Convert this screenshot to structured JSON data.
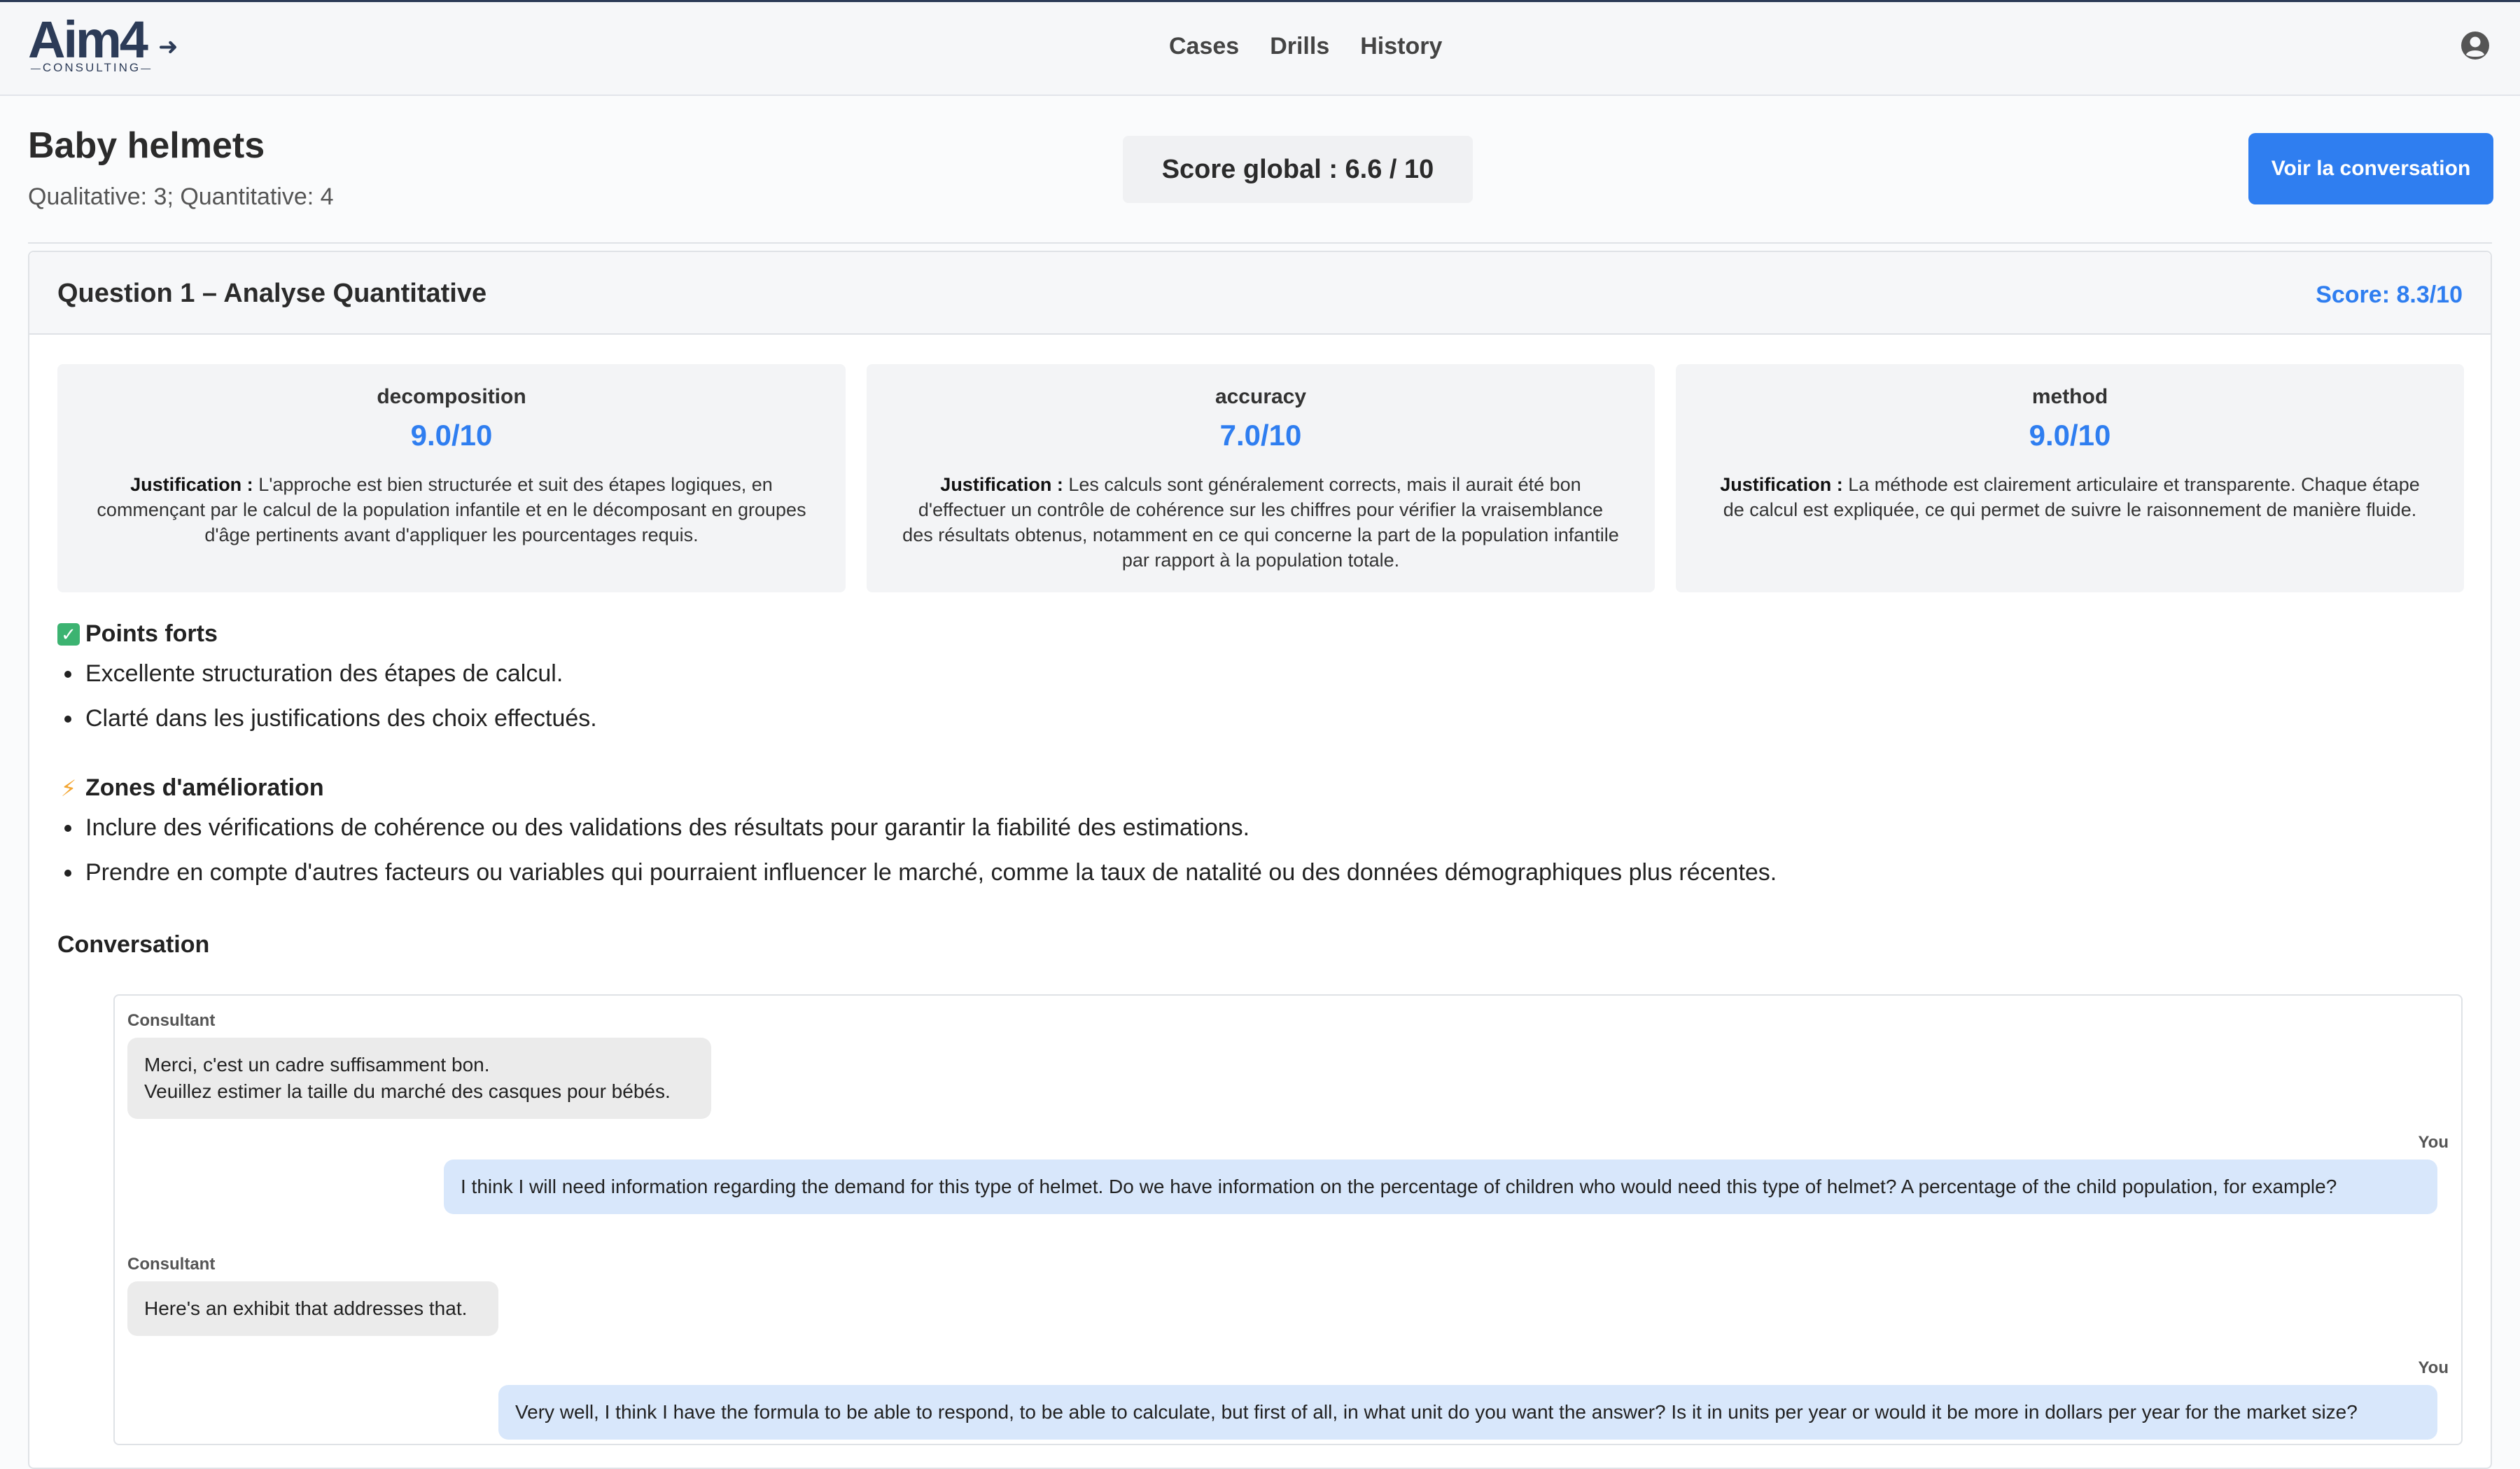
{
  "nav": {
    "logo_main": "Aim4",
    "logo_sub": "CONSULTING",
    "links": [
      "Cases",
      "Drills",
      "History"
    ]
  },
  "header": {
    "title": "Baby helmets",
    "subtitle": "Qualitative: 3; Quantitative: 4",
    "score_global": "Score global : 6.6 / 10",
    "voir_button": "Voir la conversation"
  },
  "question": {
    "title": "Question 1 – Analyse Quantitative",
    "score": "Score: 8.3/10",
    "criteria": [
      {
        "name": "decomposition",
        "score": "9.0/10",
        "just_label": "Justification :",
        "just_text": "L'approche est bien structurée et suit des étapes logiques, en commençant par le calcul de la population infantile et en le décomposant en groupes d'âge pertinents avant d'appliquer les pourcentages requis."
      },
      {
        "name": "accuracy",
        "score": "7.0/10",
        "just_label": "Justification :",
        "just_text": "Les calculs sont généralement corrects, mais il aurait été bon d'effectuer un contrôle de cohérence sur les chiffres pour vérifier la vraisemblance des résultats obtenus, notamment en ce qui concerne la part de la population infantile par rapport à la population totale."
      },
      {
        "name": "method",
        "score": "9.0/10",
        "just_label": "Justification :",
        "just_text": "La méthode est clairement articulaire et transparente. Chaque étape de calcul est expliquée, ce qui permet de suivre le raisonnement de manière fluide."
      }
    ],
    "points_forts": {
      "title": "Points forts",
      "items": [
        "Excellente structuration des étapes de calcul.",
        "Clarté dans les justifications des choix effectués."
      ]
    },
    "zones": {
      "title": "Zones d'amélioration",
      "items": [
        "Inclure des vérifications de cohérence ou des validations des résultats pour garantir la fiabilité des estimations.",
        "Prendre en compte d'autres facteurs ou variables qui pourraient influencer le marché, comme la taux de natalité ou des données démographiques plus récentes."
      ]
    },
    "conversation": {
      "title": "Conversation",
      "messages": [
        {
          "who": "Consultant",
          "text": "Merci, c'est un cadre suffisamment bon.\nVeuillez estimer la taille du marché des casques pour bébés."
        },
        {
          "who": "You",
          "text": "I think I will need information regarding the demand for this type of helmet. Do we have information on the percentage of children who would need this type of helmet? A percentage of the child population, for example?"
        },
        {
          "who": "Consultant",
          "text": "Here's an exhibit that addresses that."
        },
        {
          "who": "You",
          "text": "Very well, I think I have the formula to be able to respond, to be able to calculate, but first of all, in what unit do you want the answer? Is it in units per year or would it be more in dollars per year for the market size?"
        }
      ]
    }
  },
  "colors": {
    "accent": "#2f7ef0",
    "brand": "#2c3b57",
    "you_bubble": "#d8e7fb",
    "consultant_bubble": "#ebebeb"
  }
}
